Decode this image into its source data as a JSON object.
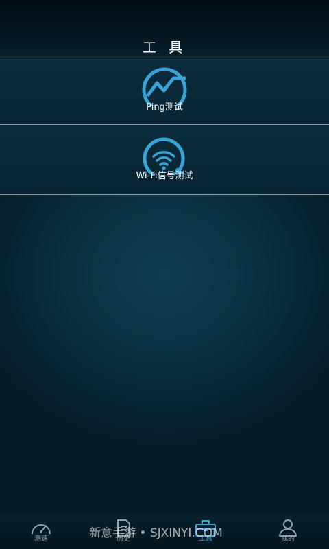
{
  "header": {
    "title": "工 具"
  },
  "tools": [
    {
      "label": "Ping测试",
      "icon": "ping-chart-icon"
    },
    {
      "label": "Wi-Fi信号测试",
      "icon": "wifi-search-icon"
    }
  ],
  "bottom_nav": {
    "tabs": [
      {
        "label": "测速",
        "icon": "speedometer-icon",
        "active": false
      },
      {
        "label": "历史",
        "icon": "document-icon",
        "active": false
      },
      {
        "label": "工具",
        "icon": "toolbox-icon",
        "active": true
      },
      {
        "label": "我的",
        "icon": "person-icon",
        "active": false
      }
    ]
  },
  "watermark": {
    "text": "新意手游 • SJXINYI.COM"
  },
  "colors": {
    "accent": "#3aa3d6",
    "background": "#0a3142",
    "divider": "#8d989e",
    "nav_inactive": "#8fa1aa"
  }
}
